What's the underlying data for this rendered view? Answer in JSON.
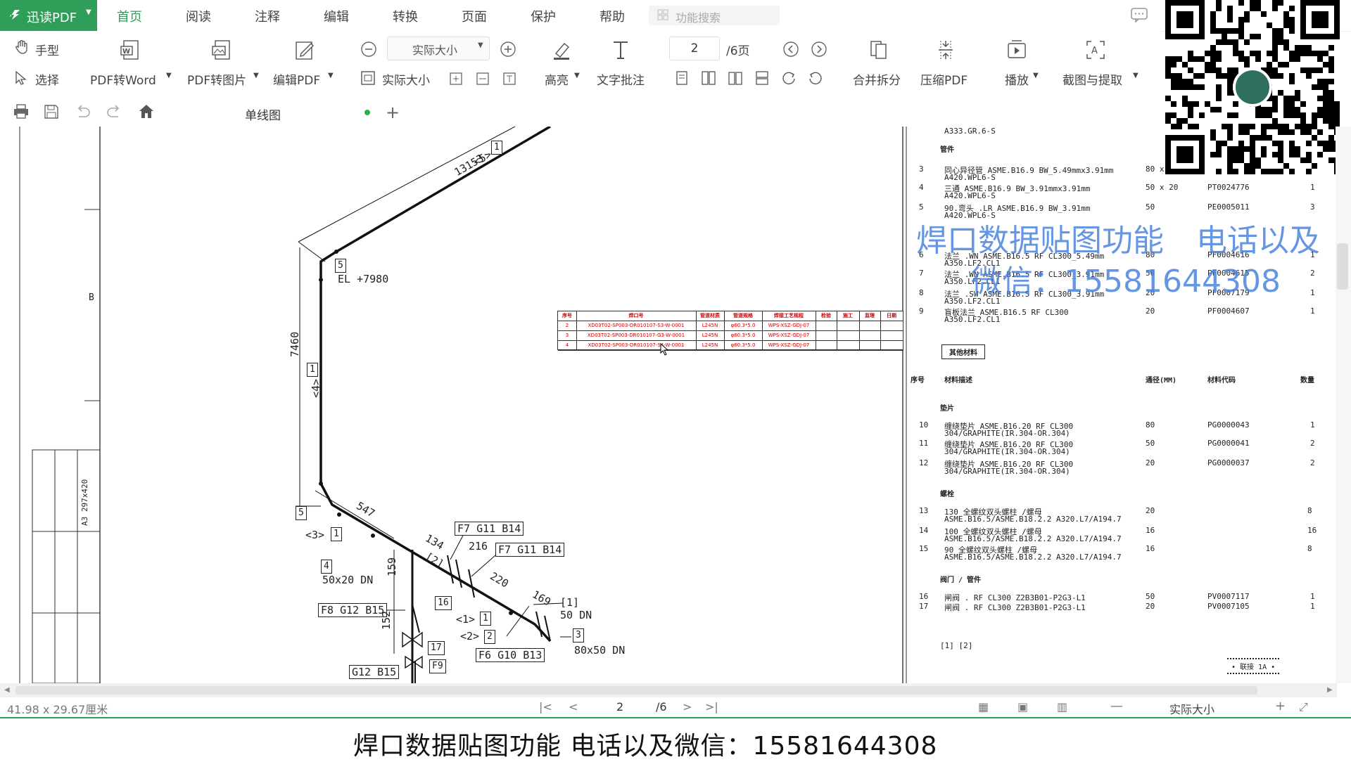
{
  "app": {
    "brand": "迅读PDF"
  },
  "menu": [
    "首页",
    "阅读",
    "注释",
    "编辑",
    "转换",
    "页面",
    "保护",
    "帮助"
  ],
  "search_placeholder": "功能搜索",
  "toolbar": {
    "hand": "手型",
    "select": "选择",
    "pdf_to_word": "PDF转Word",
    "pdf_to_image": "PDF转图片",
    "edit_pdf": "编辑PDF",
    "zoom_value": "实际大小",
    "actual_size": "实际大小",
    "highlight": "高亮",
    "text_note": "文字批注",
    "page_current": "2",
    "page_total": "/6页",
    "merge_split": "合并拆分",
    "compress": "压缩PDF",
    "play": "播放",
    "capture": "截图与提取"
  },
  "tab": {
    "title": "单线图"
  },
  "drawing": {
    "frame_label_b": "B",
    "frame_label_a3": "A3 297x420",
    "dim_13153": "13153",
    "dim_7460": "7460",
    "dim_547": "547",
    "dim_134": "134",
    "dim_216": "216",
    "dim_220": "220",
    "dim_169": "169",
    "dim_159": "159",
    "dim_152": "152",
    "elev": "EL +7980",
    "ref5": "<5>",
    "ref4": "<4>",
    "ref3": "<3>",
    "ref2": "<2>",
    "ref1": "<1>",
    "tag_f7_g11_b14_a": "F7 G11 B14",
    "tag_f7_g11_b14_b": "F7 G11 B14",
    "tag_f8_g12_b15": "F8 G12 B15",
    "tag_g12_b15": "G12 B15",
    "tag_f6_g10_b13": "F6 G10 B13",
    "tag_f9": "F9",
    "lbl_50x20": "50x20 DN",
    "lbl_50dn": "50 DN",
    "lbl_80x50": "80x50 DN",
    "lbl_bracket1": "[1]",
    "lbl_bracket2": "[2]",
    "box5a": "5",
    "box5b": "5",
    "box1a": "1",
    "box1b": "1",
    "box1c": "1",
    "box1d": "1",
    "box4": "4",
    "box16": "16",
    "box17": "17",
    "box2": "2",
    "box3": "3"
  },
  "weld_table": {
    "headers": [
      "序号",
      "焊口号",
      "管道材质",
      "管道规格",
      "焊接工艺规程",
      "检验",
      "施工",
      "监理",
      "日期"
    ],
    "rows": [
      [
        "2",
        "XD03T02-SP003-DR010107-S3-W-0001",
        "L245N",
        "φ60.3*5.0",
        "WPS-XSZ-GDJ-07"
      ],
      [
        "3",
        "XD03T02-SP003-DR010107-G3-W-0001",
        "L245N",
        "φ60.3*5.0",
        "WPS-XSZ-GDJ-07"
      ],
      [
        "4",
        "XD03T02-SP003-DR010107-S4-W-0001",
        "L245N",
        "φ60.3*5.0",
        "WPS-XSZ-GDJ-07"
      ]
    ]
  },
  "material_list": {
    "top_line": "A333.GR.6-S",
    "section_fittings": "管件",
    "items_top": [
      {
        "no": "3",
        "desc": "同心异径管   ASME.B16.9 BW_5.49mmx3.91mm",
        "desc2": "A420.WPL6-S",
        "size": "80 x",
        "code": "",
        "qty": ""
      },
      {
        "no": "4",
        "desc": "三通  ASME.B16.9 BW_3.91mmx3.91mm",
        "desc2": "A420.WPL6-S",
        "size": "50 x 20",
        "code": "PT0024776",
        "qty": "1"
      },
      {
        "no": "5",
        "desc": "90.弯头 .LR ASME.B16.9 BW_3.91mm",
        "desc2": "A420.WPL6-S",
        "size": "50",
        "code": "PE0005011",
        "qty": "3"
      },
      {
        "no": "6",
        "desc": "法兰 .WN ASME.B16.5 RF CL300_5.49mm",
        "desc2": "A350.LF2.CL1",
        "size": "80",
        "code": "PF0004616",
        "qty": "1"
      },
      {
        "no": "7",
        "desc": "法兰 .WN ASME.B16.5 RF CL300_3.91mm",
        "desc2": "A350.LF2.CL1",
        "size": "50",
        "code": "PF0004615",
        "qty": "2"
      },
      {
        "no": "8",
        "desc": "法兰 .SW ASME.B16.5 RF CL300_3.91mm",
        "desc2": "A350.LF2.CL1",
        "size": "20",
        "code": "PF0007179",
        "qty": "1"
      },
      {
        "no": "9",
        "desc": "盲板法兰   ASME.B16.5 RF CL300",
        "desc2": "A350.LF2.CL1",
        "size": "20",
        "code": "PF0004607",
        "qty": "1"
      }
    ],
    "other_materials": "其他材料",
    "headers": {
      "no": "序号",
      "desc": "材料描述",
      "dn": "通径(MM)",
      "code": "材料代码",
      "qty": "数量"
    },
    "section_gasket": "垫片",
    "items_gasket": [
      {
        "no": "10",
        "desc": "缠绕垫片   ASME.B16.20 RF CL300",
        "desc2": "304/GRAPHITE(IR.304-OR.304)",
        "size": "80",
        "code": "PG0000043",
        "qty": "1"
      },
      {
        "no": "11",
        "desc": "缠绕垫片   ASME.B16.20 RF CL300",
        "desc2": "304/GRAPHITE(IR.304-OR.304)",
        "size": "50",
        "code": "PG0000041",
        "qty": "2"
      },
      {
        "no": "12",
        "desc": "缠绕垫片   ASME.B16.20 RF CL300",
        "desc2": "304/GRAPHITE(IR.304-OR.304)",
        "size": "20",
        "code": "PG0000037",
        "qty": "2"
      }
    ],
    "section_bolt": "螺栓",
    "items_bolt": [
      {
        "no": "13",
        "desc": "130 全螺纹双头螺柱   /螺母",
        "desc2": "ASME.B16.5/ASME.B18.2.2   A320.L7/A194.7",
        "size": "20",
        "code": "",
        "qty": "8"
      },
      {
        "no": "14",
        "desc": "100 全螺纹双头螺柱   /螺母",
        "desc2": "ASME.B16.5/ASME.B18.2.2   A320.L7/A194.7",
        "size": "16",
        "code": "",
        "qty": "16"
      },
      {
        "no": "15",
        "desc": "90 全螺纹双头螺柱   /螺母",
        "desc2": "ASME.B16.5/ASME.B18.2.2   A320.L7/A194.7",
        "size": "16",
        "code": "",
        "qty": "8"
      }
    ],
    "section_valve": "阀门 / 管件",
    "items_valve": [
      {
        "no": "16",
        "desc": "闸阀   . RF CL300 Z2B3B01-P2G3-L1",
        "size": "50",
        "code": "PV0007117",
        "qty": "1"
      },
      {
        "no": "17",
        "desc": "闸阀   . RF CL300 Z2B3B01-P2G3-L1",
        "size": "20",
        "code": "PV0007105",
        "qty": "1"
      }
    ],
    "footnote": "[1] [2]",
    "stamp": "• 联接    1A •"
  },
  "watermark": {
    "line1a": "焊口数据贴图功能",
    "line1b": "电话以及",
    "line2": "微信：15581644308"
  },
  "status": {
    "page_size": "41.98 x 29.67厘米",
    "page_current": "2",
    "page_total": "/6",
    "zoom": "实际大小"
  },
  "subtitle": "焊口数据贴图功能     电话以及微信：15581644308"
}
